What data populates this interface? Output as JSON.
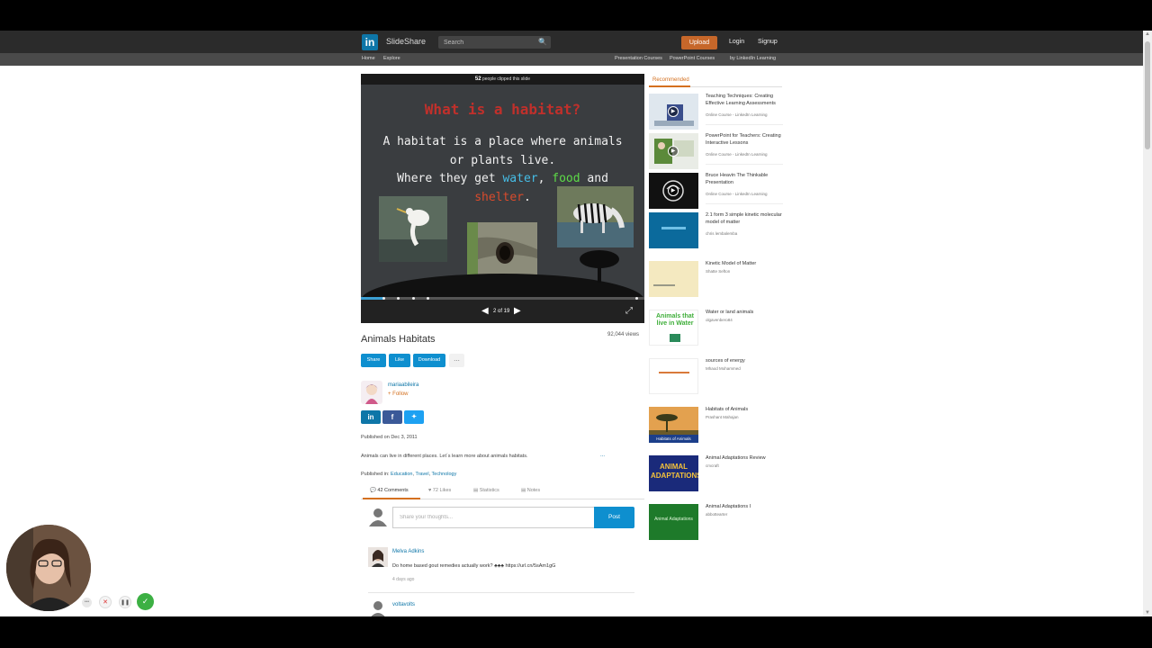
{
  "header": {
    "logo_mark": "in",
    "logo_text": "SlideShare",
    "search_placeholder": "Search",
    "upload_label": "Upload",
    "login_label": "Login",
    "signup_label": "Signup"
  },
  "subnav": {
    "home": "Home",
    "explore": "Explore",
    "presentation_courses": "Presentation Courses",
    "powerpoint_courses": "PowerPoint Courses",
    "linkedin_learning": "by LinkedIn Learning"
  },
  "player": {
    "clip_count": "52",
    "clip_text": "people clipped this slide",
    "slide_title": "What is a habitat?",
    "slide_line1": "A habitat is a place where animals",
    "slide_line2": "or plants live.",
    "slide_line3_pre": "Where they get",
    "slide_kw_water": "water",
    "slide_comma": ",",
    "slide_kw_food": "food",
    "slide_and": "and",
    "slide_kw_shelter": "shelter",
    "slide_period": ".",
    "page_indicator": "2 of 19",
    "progress_fraction": 0.08
  },
  "document": {
    "title": "Animals Habitats",
    "views": "92,044 views",
    "share_label": "Share",
    "like_label": "Like",
    "download_label": "Download",
    "more_label": "...",
    "author": "mariaabileira",
    "follow_label": "+ Follow",
    "published": "Published on Dec 3, 2011",
    "description": "Animals can live in different places. Let´s learn more about animals habitats.",
    "description_more": "...",
    "published_in_label": "Published in:",
    "categories": [
      "Education",
      "Travel",
      "Technology"
    ]
  },
  "tabs": {
    "comments": "42 Comments",
    "likes": "72 Likes",
    "statistics": "Statistics",
    "notes": "Notes"
  },
  "comments": {
    "input_placeholder": "Share your thoughts...",
    "post_label": "Post",
    "items": [
      {
        "name": "Melva Adkins",
        "text": "Do home based gout remedies actually work? ♣♣♣ https://url.cn/5sAm1gG",
        "time": "4 days ago"
      },
      {
        "name": "voltavolts"
      }
    ]
  },
  "recommended": {
    "label": "Recommended",
    "items": [
      {
        "title": "Teaching Techniques: Creating Effective Learning Assessments",
        "sub": "Online Course - LinkedIn Learning"
      },
      {
        "title": "PowerPoint for Teachers: Creating Interactive Lessons",
        "sub": "Online Course - LinkedIn Learning"
      },
      {
        "title": "Bruce Heavin The Thinkable Presentation",
        "sub": "Online Course - LinkedIn Learning"
      },
      {
        "title": "2.1 form 3 simple kinetic molecular model of matter",
        "sub": "chris lembalemba"
      },
      {
        "title": "Kinetic Model of Matter",
        "sub": "Shatte Sefton"
      },
      {
        "title": "Water or land animals",
        "sub": "olgavenbero84"
      },
      {
        "title": "sources of energy",
        "sub": "Mhaod Mohammed"
      },
      {
        "title": "Habitats of Animals",
        "sub": "Prashant Mahajan"
      },
      {
        "title": "Animal Adaptations Review",
        "sub": "cmcraft"
      },
      {
        "title": "Animal Adaptations I",
        "sub": "abbottearter"
      }
    ],
    "thumb_texts": {
      "water_animals": "Animals that live in Water",
      "habitats": "Habitats of Animals",
      "adaptations": "ANIMAL ADAPTATIONS",
      "adaptations_i": "Animal Adaptations"
    }
  },
  "colors": {
    "accent_orange": "#d4701f",
    "link_blue": "#0e76a8",
    "button_blue": "#0e8fcf",
    "upload_orange": "#c6672a",
    "linkedin_blue": "#0e76a8",
    "facebook_blue": "#3b5998",
    "twitter_blue": "#1da1f2"
  }
}
